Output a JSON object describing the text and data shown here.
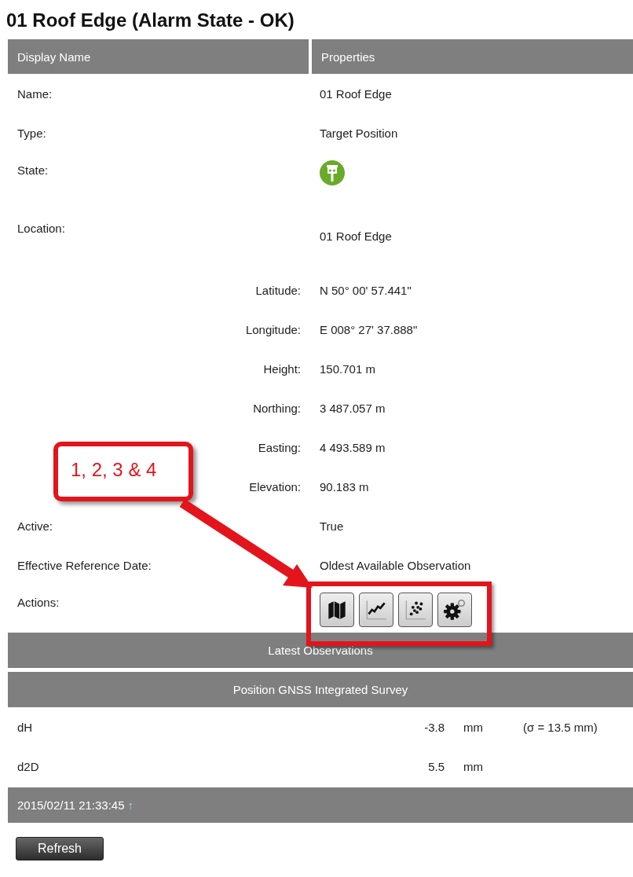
{
  "title": "01 Roof Edge (Alarm State - OK)",
  "table": {
    "columns": [
      "Display Name",
      "Properties"
    ],
    "rows": [
      {
        "kind": "text",
        "label": "Name:",
        "value": "01 Roof Edge"
      },
      {
        "kind": "text",
        "label": "Type:",
        "value": "Target Position"
      },
      {
        "kind": "state",
        "label": "State:"
      },
      {
        "kind": "location",
        "label": "Location:",
        "value": "01 Roof Edge"
      },
      {
        "kind": "sub",
        "label": "Latitude:",
        "value": "N 50° 00' 57.441\""
      },
      {
        "kind": "sub",
        "label": "Longitude:",
        "value": "E 008° 27' 37.888\""
      },
      {
        "kind": "sub",
        "label": "Height:",
        "value": "150.701 m"
      },
      {
        "kind": "sub",
        "label": "Northing:",
        "value": "3 487.057 m"
      },
      {
        "kind": "sub",
        "label": "Easting:",
        "value": "4 493.589 m"
      },
      {
        "kind": "sub",
        "label": "Elevation:",
        "value": "90.183 m"
      },
      {
        "kind": "text",
        "label": "Active:",
        "value": "True"
      },
      {
        "kind": "text",
        "label": "Effective Reference Date:",
        "value": "Oldest Available Observation"
      },
      {
        "kind": "actions",
        "label": "Actions:",
        "buttons": [
          {
            "kind": "map"
          },
          {
            "kind": "line"
          },
          {
            "kind": "scatter"
          },
          {
            "kind": "gear"
          }
        ]
      }
    ]
  },
  "latest_observations": {
    "heading": "Latest Observations",
    "subheading": "Position GNSS Integrated Survey",
    "rows": [
      {
        "name": "dH",
        "value": "-3.8",
        "unit": "mm",
        "sigma": "(σ = 13.5 mm)"
      },
      {
        "name": "d2D",
        "value": "5.5",
        "unit": "mm"
      }
    ]
  },
  "timestamp": {
    "text": "2015/02/11 21:33:45",
    "trend": "↑"
  },
  "refresh_button": "Refresh",
  "annotation": {
    "label": "1, 2, 3 & 4"
  }
}
